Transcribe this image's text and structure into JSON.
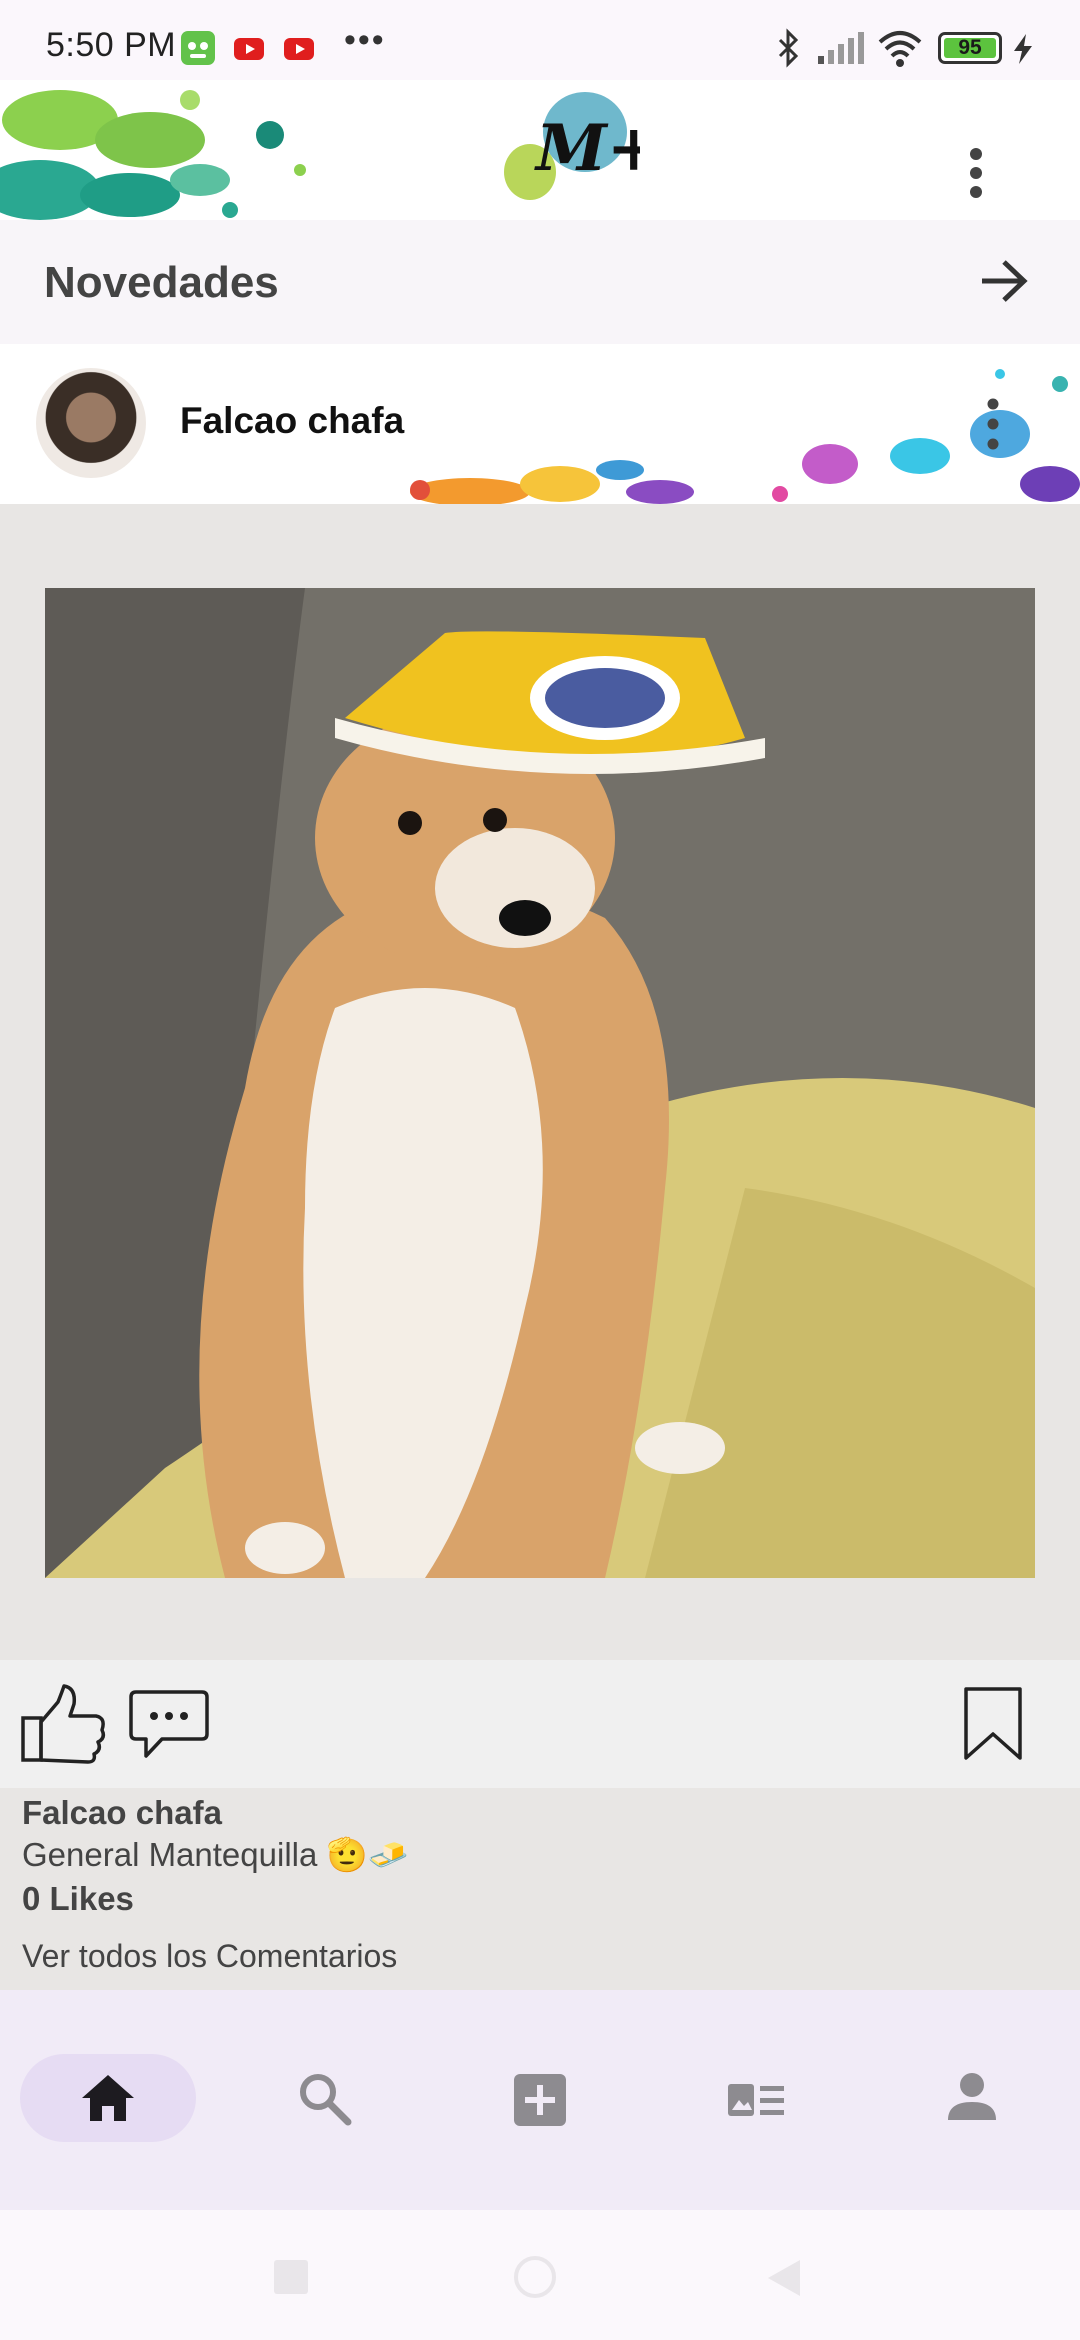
{
  "status_bar": {
    "time": "5:50 PM",
    "battery": "95",
    "icons": [
      "robot-notification-icon",
      "youtube-icon",
      "youtube-icon",
      "more-icon",
      "bluetooth-icon",
      "signal-icon",
      "wifi-icon",
      "battery-icon",
      "charging-icon"
    ]
  },
  "header": {
    "logo_text": "M+",
    "menu_icon": "more-vert-icon"
  },
  "section": {
    "title": "Novedades",
    "forward_icon": "arrow-right-icon"
  },
  "post": {
    "author": "Falcao chafa",
    "menu_icon": "more-vert-icon",
    "image_alt_icon": "shiba-dog-photo",
    "caption_author": "Falcao chafa",
    "caption_text": "General Mantequilla 🫡🧈",
    "likes": "0 Likes",
    "view_comments": "Ver todos los Comentarios"
  },
  "actions": {
    "like_icon": "thumbs-up-icon",
    "comment_icon": "comment-icon",
    "bookmark_icon": "bookmark-icon"
  },
  "bottom_nav": {
    "items": [
      {
        "icon": "home-icon",
        "active": true
      },
      {
        "icon": "search-icon",
        "active": false
      },
      {
        "icon": "add-box-icon",
        "active": false
      },
      {
        "icon": "feed-icon",
        "active": false
      },
      {
        "icon": "person-icon",
        "active": false
      }
    ]
  },
  "colors": {
    "active_pill": "#e6dcf3",
    "nav_bg": "#f1ebf7",
    "text_dark": "#444444"
  }
}
